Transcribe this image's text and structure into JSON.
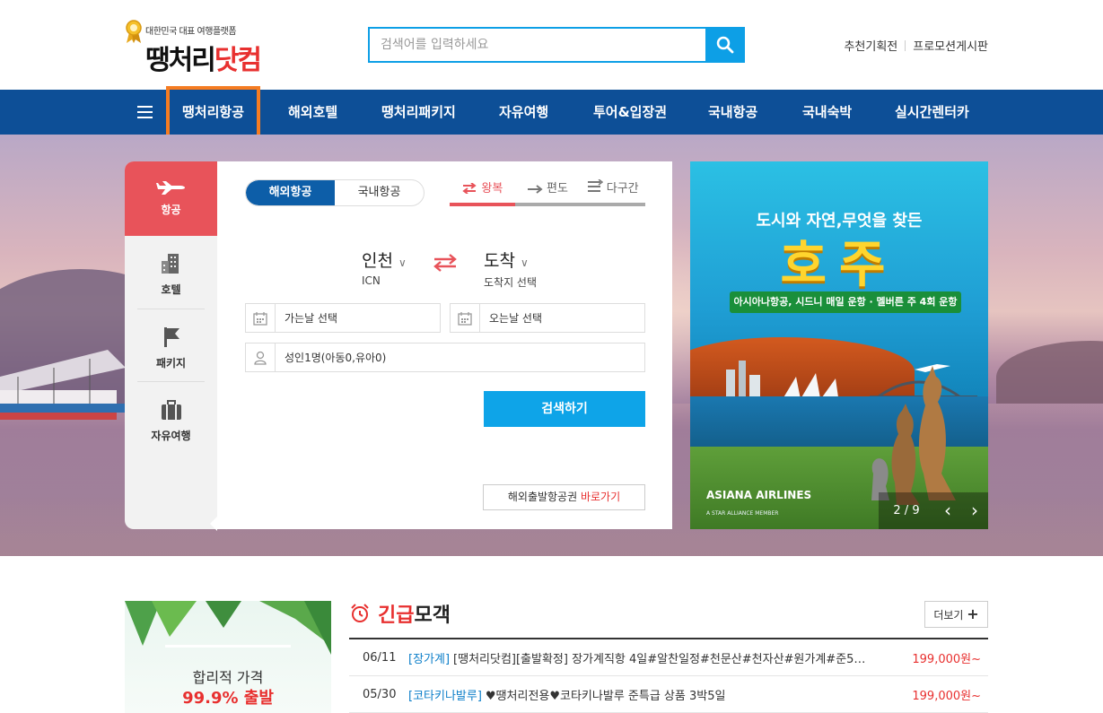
{
  "header": {
    "logo_tagline": "대한민국 대표 여행플랫폼",
    "logo_text_a": "땡처리",
    "logo_text_b": "닷컴",
    "search_placeholder": "검색어를 입력하세요",
    "top_links": [
      "추천기획전",
      "프로모션게시판"
    ]
  },
  "nav": {
    "items": [
      "땡처리항공",
      "해외호텔",
      "땡처리패키지",
      "자유여행",
      "투어&입장권",
      "국내항공",
      "국내숙박",
      "실시간렌터카"
    ],
    "active_index": 0
  },
  "side_tabs": [
    "항공",
    "호텔",
    "패키지",
    "자유여행"
  ],
  "booking": {
    "segments": [
      "해외항공",
      "국내항공"
    ],
    "trip_types": [
      "왕복",
      "편도",
      "다구간"
    ],
    "from": {
      "name": "인천",
      "code": "ICN"
    },
    "to": {
      "name": "도착",
      "code": "도착지 선택"
    },
    "depart_date": "가는날 선택",
    "return_date": "오는날 선택",
    "passengers": "성인1명(아동0,유아0)",
    "search_label": "검색하기",
    "ticket_link_text": "해외출발항공권",
    "ticket_link_cta": "바로가기"
  },
  "banner": {
    "subtitle": "도시와 자연,무엇을 찾든",
    "title": "호주",
    "ribbon": "아시아나항공, 시드니 매일 운항 · 멜버른 주 4회 운항",
    "airline": "ASIANA AIRLINES",
    "airline_sub": "A STAR ALLIANCE MEMBER",
    "pager": "2 / 9",
    "current": 2,
    "total": 9
  },
  "promo": {
    "line1": "합리적 가격",
    "line2": "99.9% 출발"
  },
  "urgent": {
    "title_red": "긴급",
    "title_black": "모객",
    "more_label": "더보기",
    "rows": [
      {
        "date": "06/11",
        "tag": "[장가계]",
        "desc": "[땡처리닷컴][출발확정] 장가계직항 4일#알찬일정#천문산#천자산#원가계#준5…",
        "price": "199,000원~"
      },
      {
        "date": "05/30",
        "tag": "[코타키나발루]",
        "desc": "♥땡처리전용♥코타키나발루 준특급 상품 3박5일",
        "price": "199,000원~"
      }
    ]
  },
  "colors": {
    "nav_bg": "#0d4f97",
    "accent_blue": "#0ea4e8",
    "accent_red": "#e8535a",
    "highlight_orange": "#f57c22",
    "price_red": "#e8302f"
  }
}
